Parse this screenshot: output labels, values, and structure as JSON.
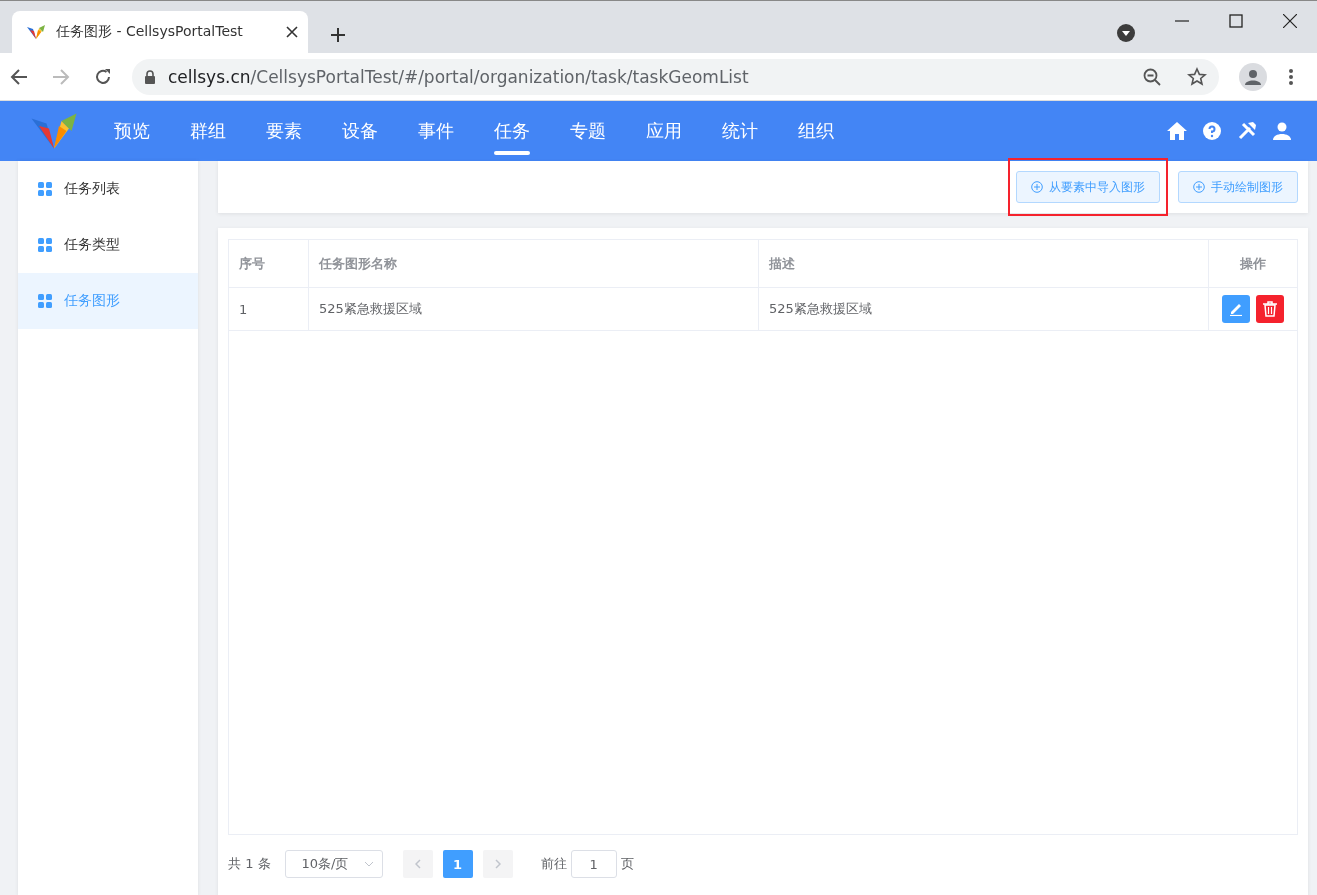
{
  "browser": {
    "tab_title": "任务图形 - CellsysPortalTest",
    "url_host": "cellsys.cn",
    "url_path": "/CellsysPortalTest/#/portal/organization/task/taskGeomList"
  },
  "nav": [
    {
      "label": "预览",
      "selected": false
    },
    {
      "label": "群组",
      "selected": false
    },
    {
      "label": "要素",
      "selected": false
    },
    {
      "label": "设备",
      "selected": false
    },
    {
      "label": "事件",
      "selected": false
    },
    {
      "label": "任务",
      "selected": true
    },
    {
      "label": "专题",
      "selected": false
    },
    {
      "label": "应用",
      "selected": false
    },
    {
      "label": "统计",
      "selected": false
    },
    {
      "label": "组织",
      "selected": false
    }
  ],
  "sidebar": {
    "items": [
      {
        "label": "任务列表",
        "selected": false
      },
      {
        "label": "任务类型",
        "selected": false
      },
      {
        "label": "任务图形",
        "selected": true
      }
    ]
  },
  "toolbar": {
    "buttons": [
      {
        "label": "从要素中导入图形",
        "highlighted": true
      },
      {
        "label": "手动绘制图形",
        "highlighted": false
      }
    ]
  },
  "table": {
    "columns": [
      "序号",
      "任务图形名称",
      "描述",
      "操作"
    ],
    "rows": [
      {
        "index": "1",
        "name": "525紧急救援区域",
        "description": "525紧急救援区域"
      }
    ]
  },
  "pagination": {
    "total": "共 1 条",
    "page_size": "10条/页",
    "pages": [
      {
        "label": "1",
        "selected": true
      }
    ],
    "goto_label": "前往",
    "goto_value": "1",
    "goto_suffix": "页"
  }
}
